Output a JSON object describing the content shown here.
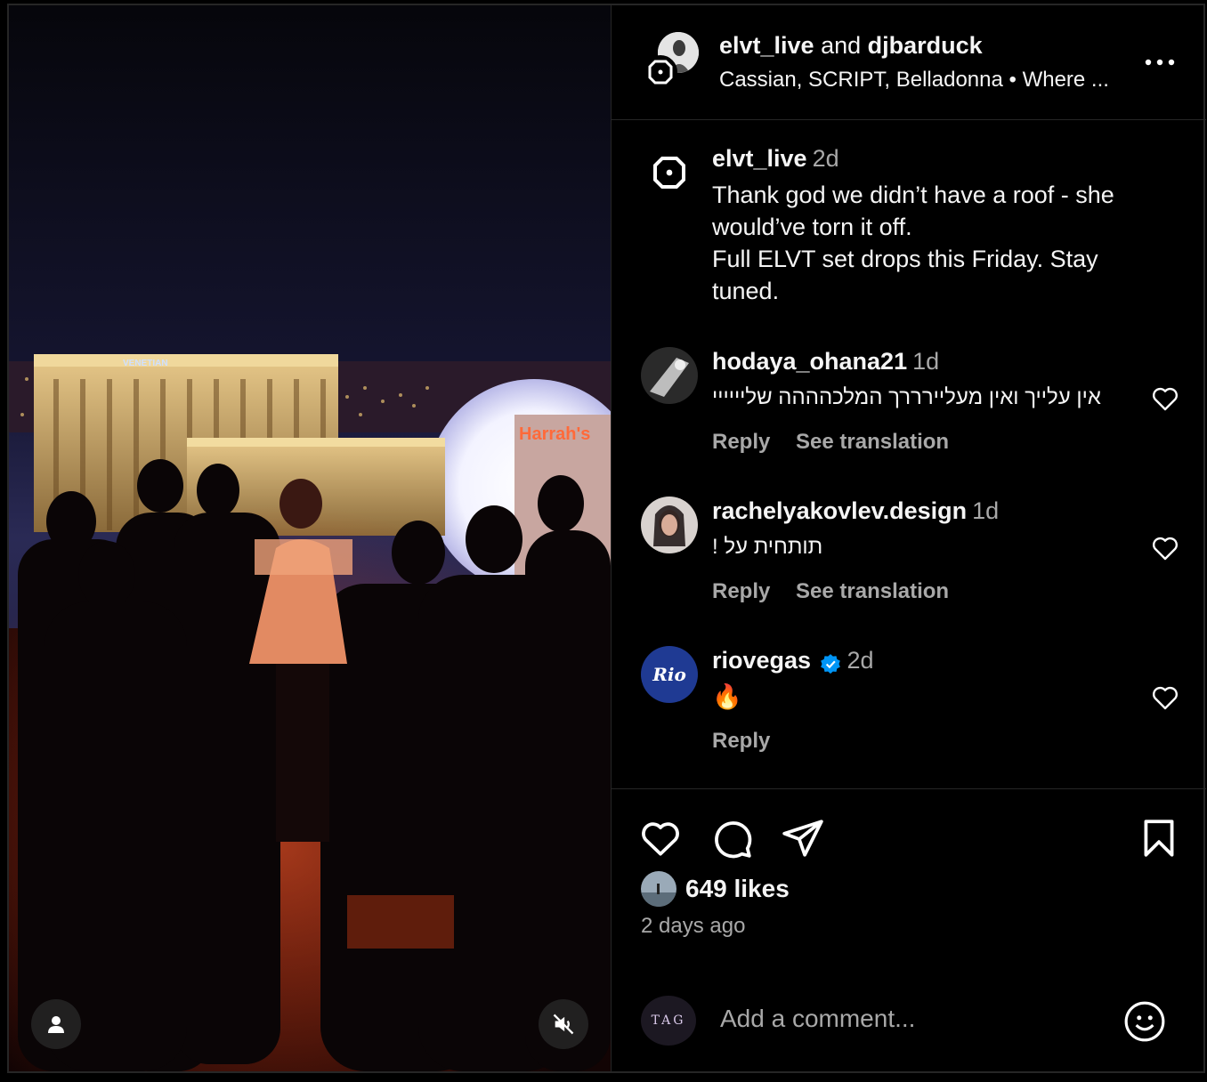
{
  "header": {
    "user1": "elvt_live",
    "and": "and",
    "user2": "djbarduck",
    "subtitle": "Cassian, SCRIPT, Belladonna • Where ...",
    "more_icon": "more-horizontal-icon"
  },
  "media": {
    "sign_venetian": "VENETIAN",
    "sign_harrahs": "Harrah's",
    "tag_icon": "user-icon",
    "mute_icon": "speaker-muted-icon"
  },
  "caption": {
    "user": "elvt_live",
    "time": "2d",
    "line1": "Thank god we didn’t have a roof - she would’ve torn it off.",
    "line2": "Full ELVT set drops this Friday. Stay tuned."
  },
  "comments": [
    {
      "user": "hodaya_ohana21",
      "time": "1d",
      "text": "אין עלייך ואין מעליירררך המלכהההה שליייייי",
      "reply": "Reply",
      "translate": "See translation"
    },
    {
      "user": "rachelyakovlev.design",
      "time": "1d",
      "text": "תותחית על !",
      "reply": "Reply",
      "translate": "See translation"
    },
    {
      "user": "riovegas",
      "time": "2d",
      "text": "🔥",
      "reply": "Reply",
      "avatar_text": "Rio"
    }
  ],
  "footer": {
    "likes": "649 likes",
    "time_ago": "2 days ago",
    "comment_placeholder": "Add a comment...",
    "commenter_avatar_text": "TAG"
  },
  "colors": {
    "background": "#000000",
    "border": "#262626",
    "secondary_text": "#a8a8a8",
    "verified": "#0095f6",
    "rio_blue": "#1f3a93"
  }
}
